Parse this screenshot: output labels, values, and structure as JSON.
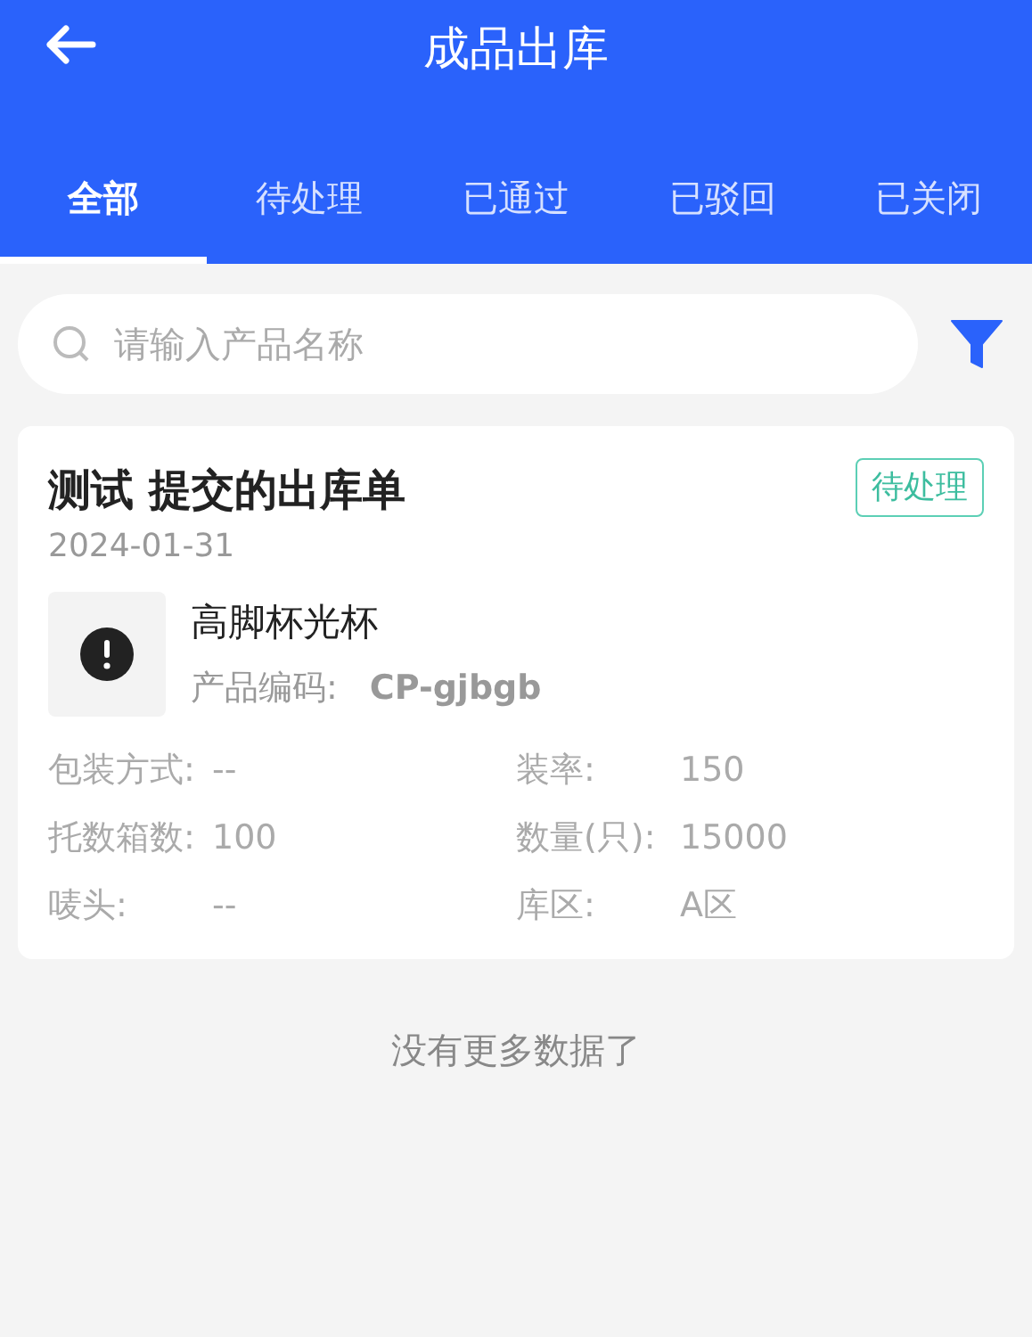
{
  "header": {
    "title": "成品出库"
  },
  "tabs": [
    {
      "label": "全部",
      "selected": true
    },
    {
      "label": "待处理",
      "selected": false
    },
    {
      "label": "已通过",
      "selected": false
    },
    {
      "label": "已驳回",
      "selected": false
    },
    {
      "label": "已关闭",
      "selected": false
    }
  ],
  "search": {
    "placeholder": "请输入产品名称"
  },
  "orders": [
    {
      "title": "测试 提交的出库单",
      "status": "待处理",
      "date": "2024-01-31",
      "product_name": "高脚杯光杯",
      "code_label": "产品编码:",
      "code": "CP-gjbgb",
      "spec_rows": [
        [
          {
            "label": "包装方式:",
            "value": "--"
          },
          {
            "label": "装率:",
            "value": "150"
          }
        ],
        [
          {
            "label": "托数箱数:",
            "value": "100"
          },
          {
            "label": "数量(只):",
            "value": "15000"
          }
        ],
        [
          {
            "label": "唛头:",
            "value": "--"
          },
          {
            "label": "库区:",
            "value": "A区"
          }
        ]
      ]
    }
  ],
  "footer": "没有更多数据了"
}
